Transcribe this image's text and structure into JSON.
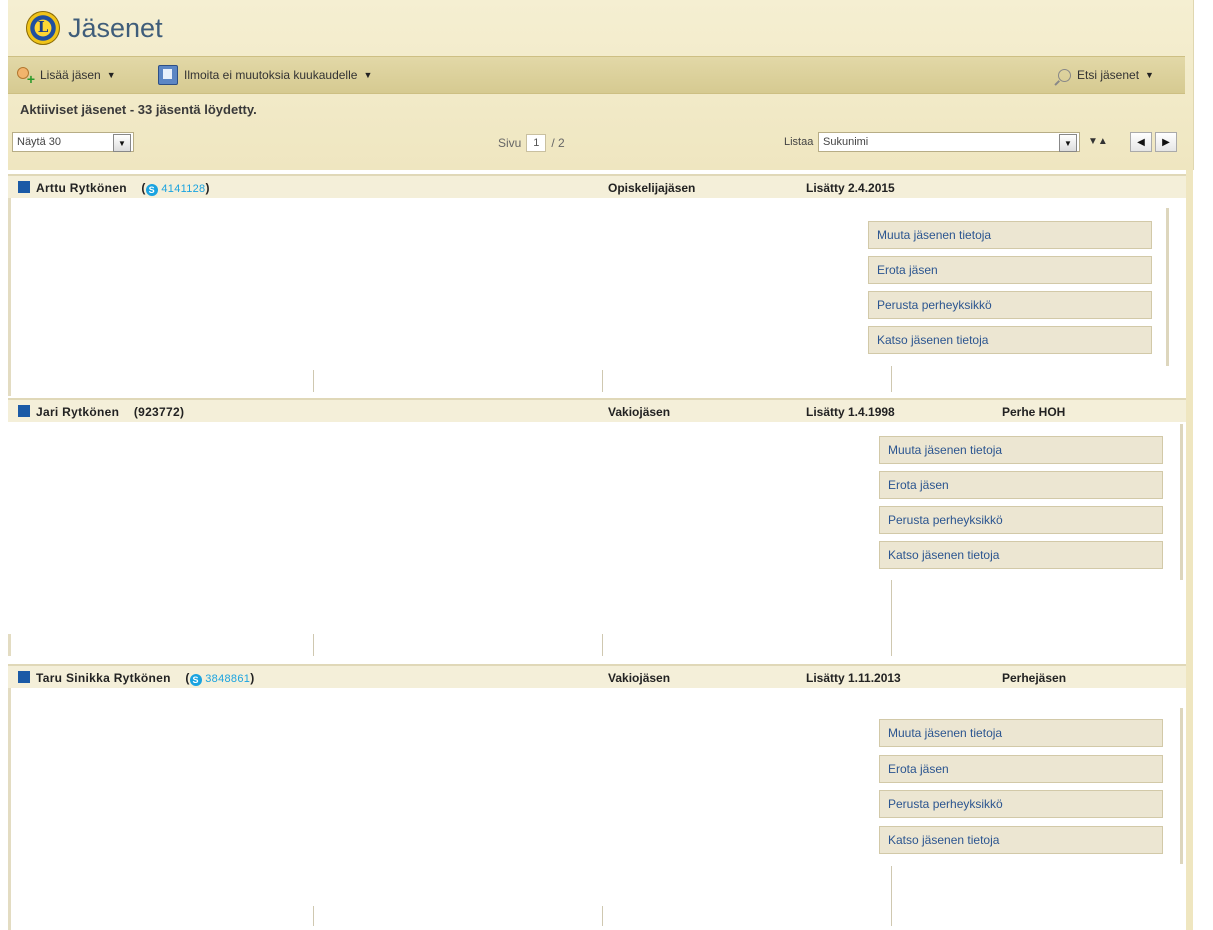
{
  "header": {
    "title": "Jäsenet",
    "logo_icon": "lions-club-logo-icon"
  },
  "toolbar": {
    "add_member_label": "Lisää jäsen",
    "report_label": "Ilmoita ei muutoksia kuukaudelle",
    "search_label": "Etsi jäsenet"
  },
  "status": {
    "text": "Aktiiviset jäsenet - 33 jäsentä löydetty."
  },
  "controls": {
    "show_label": "Näytä 30",
    "page_label": "Sivu",
    "page_current": "1",
    "page_total": "/ 2",
    "sort_label": "Listaa",
    "sort_value": "Sukunimi"
  },
  "actions": {
    "edit": "Muuta jäsenen tietoja",
    "remove": "Erota jäsen",
    "family": "Perusta perheyksikkö",
    "view": "Katso jäsenen tietoja"
  },
  "members": [
    {
      "name": "Arttu Rytkönen",
      "open": "(",
      "id": "4141128",
      "close": ")",
      "type": "Opiskelijajäsen",
      "added": "Lisätty 2.4.2015",
      "role": ""
    },
    {
      "name": "Jari Rytkönen",
      "id_plain": "(923772)",
      "type": "Vakiojäsen",
      "added": "Lisätty 1.4.1998",
      "role": "Perhe HOH"
    },
    {
      "name": "Taru Sinikka Rytkönen",
      "open": "(",
      "id": "3848861",
      "close": ")",
      "type": "Vakiojäsen",
      "added": "Lisätty 1.11.2013",
      "role": "Perhejäsen"
    }
  ],
  "colors": {
    "panel": "#efe6c0",
    "toolbar": "#d6ca91",
    "title": "#3f5d7a",
    "link": "#2b5590",
    "skype": "#1aa3e0",
    "member_square": "#1b5aa6"
  }
}
